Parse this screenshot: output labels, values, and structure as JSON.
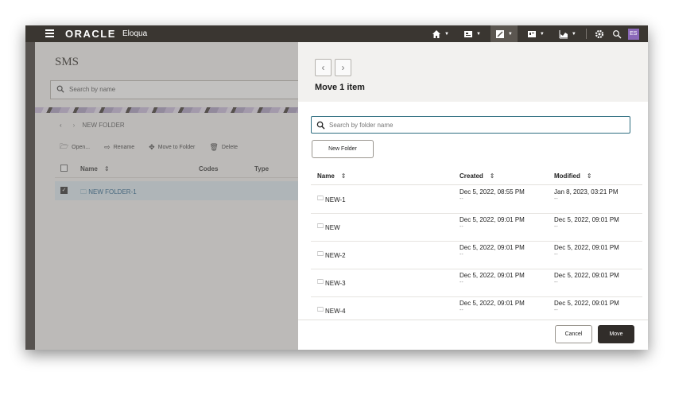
{
  "topbar": {
    "logo": "ORACLE",
    "product": "Eloqua",
    "nav_icons": [
      {
        "name": "home-icon"
      },
      {
        "name": "assets-icon"
      },
      {
        "name": "campaigns-icon"
      },
      {
        "name": "contacts-icon"
      },
      {
        "name": "insight-icon"
      }
    ],
    "user_initials": "ES"
  },
  "background_page": {
    "title": "SMS",
    "search_placeholder": "Search by name",
    "breadcrumb": "NEW FOLDER",
    "toolbar": {
      "open_label": "Open...",
      "rename_label": "Rename",
      "move_label": "Move to Folder",
      "delete_label": "Delete"
    },
    "columns": {
      "name": "Name",
      "codes": "Codes",
      "type": "Type"
    },
    "selected_row": "NEW FOLDER-1"
  },
  "dialog": {
    "title": "Move 1 item",
    "search_placeholder": "Search by folder name",
    "new_folder_label": "New Folder",
    "columns": {
      "name": "Name",
      "created": "Created",
      "modified": "Modified"
    },
    "rows": [
      {
        "name": "NEW-1",
        "created": "Dec 5, 2022, 08:55 PM",
        "modified": "Jan 8, 2023, 03:21 PM"
      },
      {
        "name": "NEW",
        "created": "Dec 5, 2022, 09:01 PM",
        "modified": "Dec 5, 2022, 09:01 PM"
      },
      {
        "name": "NEW-2",
        "created": "Dec 5, 2022, 09:01 PM",
        "modified": "Dec 5, 2022, 09:01 PM"
      },
      {
        "name": "NEW-3",
        "created": "Dec 5, 2022, 09:01 PM",
        "modified": "Dec 5, 2022, 09:01 PM"
      },
      {
        "name": "NEW-4",
        "created": "Dec 5, 2022, 09:01 PM",
        "modified": "Dec 5, 2022, 09:01 PM"
      }
    ],
    "placeholder_dash": "--",
    "cancel_label": "Cancel",
    "move_label": "Move"
  }
}
